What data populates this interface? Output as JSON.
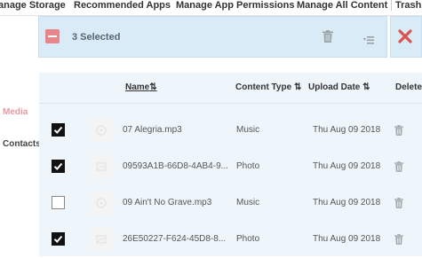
{
  "nav": {
    "items": [
      "anage Storage",
      "Recommended Apps",
      "Manage App Permissions",
      "Manage All Content",
      "Trash"
    ]
  },
  "sidebar": {
    "items": [
      {
        "label": "Media",
        "active": true
      },
      {
        "label": "Contacts",
        "active": false
      }
    ]
  },
  "action_bar": {
    "selected_text": "3 Selected"
  },
  "table": {
    "columns": {
      "name": "Name",
      "content_type": "Content Type",
      "upload_date": "Upload Date",
      "delete": "Delete"
    },
    "rows": [
      {
        "checked": true,
        "name": "07 Alegria.mp3",
        "type": "Music",
        "date": "Thu Aug 09 2018",
        "icon": "music-file-icon"
      },
      {
        "checked": true,
        "name": "09593A1B-66D8-4AB4-9...",
        "type": "Photo",
        "date": "Thu Aug 09 2018",
        "icon": "photo-file-icon"
      },
      {
        "checked": false,
        "name": "09 Ain't No Grave.mp3",
        "type": "Music",
        "date": "Thu Aug 09 2018",
        "icon": "music-file-icon"
      },
      {
        "checked": true,
        "name": "26E50227-F624-45D8-8...",
        "type": "Photo",
        "date": "Thu Aug 09 2018",
        "icon": "photo-file-icon"
      }
    ]
  },
  "colors": {
    "accent_pink": "#e8858a",
    "selection_bar": "#d8ebf6",
    "table_bg": "#eef6fb"
  }
}
